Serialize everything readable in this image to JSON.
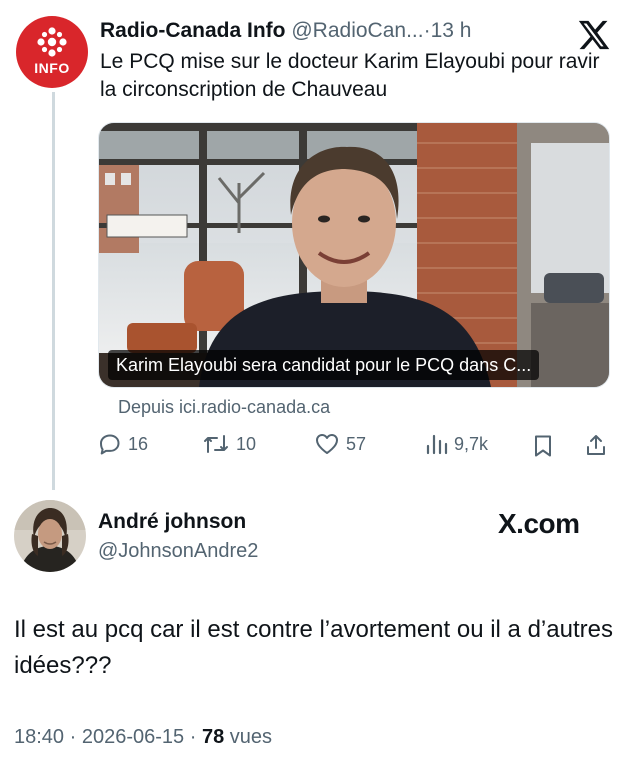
{
  "post": {
    "author_name": "Radio-Canada Info",
    "author_handle": "@RadioCan...",
    "dot": "·",
    "time": "13 h",
    "avatar_badge": "INFO",
    "text": "Le PCQ mise sur le docteur Karim Elayoubi pour ravir la circonscription de Chauveau",
    "card": {
      "caption": "Karim Elayoubi sera candidat pour le PCQ dans C...",
      "source": "Depuis ici.radio-canada.ca"
    },
    "actions": {
      "replies": "16",
      "reposts": "10",
      "likes": "57",
      "views": "9,7k"
    }
  },
  "reply": {
    "author_name": "André johnson",
    "author_handle": "@JohnsonAndre2",
    "watermark": "X.com",
    "text": "Il est au pcq car il est contre l’avortement ou il a d’autres idées???",
    "time": "18:40",
    "date": "2026-06-15",
    "views_count": "78",
    "views_label": "vues",
    "sep": "·"
  },
  "colors": {
    "brand_red": "#d9262b",
    "muted_text": "#536471",
    "text": "#0f1419"
  }
}
